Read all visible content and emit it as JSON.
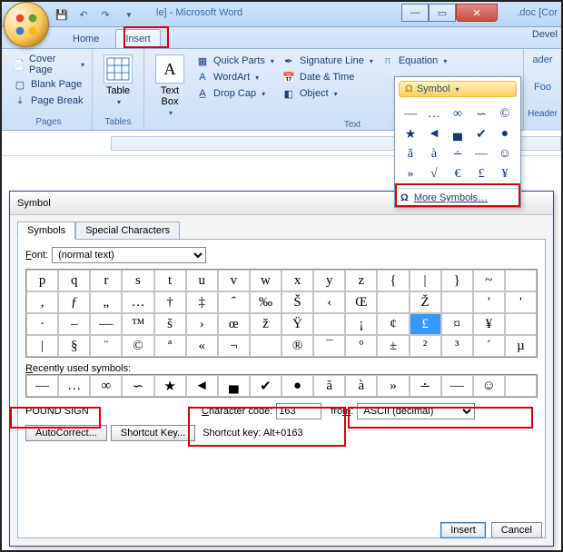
{
  "window": {
    "title": "le] - Microsoft Word",
    "doc_frag": ".doc [Cor",
    "min": "—",
    "max": "▭",
    "close": "✕"
  },
  "qat": {
    "save": "💾",
    "undo": "↶",
    "redo": "↷"
  },
  "tabs": {
    "home": "Home",
    "insert": "Insert",
    "right": "Devel"
  },
  "ribbon": {
    "pages": {
      "cover": "Cover Page",
      "blank": "Blank Page",
      "pbreak": "Page Break",
      "label": "Pages"
    },
    "tables": {
      "btn": "Table",
      "label": "Tables"
    },
    "text": {
      "box": "Text\nBox",
      "quick": "Quick Parts",
      "wordart": "WordArt",
      "drop": "Drop Cap",
      "sig": "Signature Line",
      "date": "Date & Time",
      "obj": "Object",
      "label": "Text"
    },
    "symbols": {
      "eq": "Equation",
      "sym": "Symbol",
      "more": "More Symbols…"
    },
    "right": {
      "ader": "ader",
      "foo": "Foo",
      "header": "Header"
    }
  },
  "gallery": [
    "—",
    "…",
    "∞",
    "∽",
    "©",
    "★",
    "◄",
    "▄",
    "✔",
    "●",
    "ă",
    "à",
    "∸",
    "—",
    "☺",
    "»",
    "√",
    "€",
    "£",
    "¥"
  ],
  "dialog": {
    "title": "Symbol",
    "tab_symbols": "Symbols",
    "tab_special": "Special Characters",
    "font_label": "Font:",
    "font_value": "(normal text)",
    "grid": [
      "p",
      "q",
      "r",
      "s",
      "t",
      "u",
      "v",
      "w",
      "x",
      "y",
      "z",
      "{",
      "|",
      "}",
      "~",
      "",
      ",",
      "ƒ",
      "„",
      "…",
      "†",
      "‡",
      "ˆ",
      "‰",
      "Š",
      "‹",
      "Œ",
      "",
      "Ž",
      "",
      "'",
      "'",
      "·",
      "–",
      "—",
      "™",
      "š",
      "›",
      "œ",
      "ž",
      "Ÿ",
      "",
      "¡",
      "¢",
      "£",
      "¤",
      "¥",
      "",
      "|",
      "§",
      "¨",
      "©",
      "ª",
      "«",
      "¬",
      "­",
      "®",
      "¯",
      "°",
      "±",
      "²",
      "³",
      "´",
      "µ"
    ],
    "selected_index": 44,
    "recent_label": "Recently used symbols:",
    "recent": [
      "—",
      "…",
      "∞",
      "∽",
      "★",
      "◄",
      "▄",
      "✔",
      "●",
      "ă",
      "à",
      "»",
      "∸",
      "—",
      "☺",
      ""
    ],
    "name": "POUND SIGN",
    "code_label": "Character code:",
    "code_value": "163",
    "from_label": "from:",
    "from_value": "ASCII (decimal)",
    "auto": "AutoCorrect...",
    "shortcut_btn": "Shortcut Key...",
    "shortcut": "Shortcut key: Alt+0163",
    "insert": "Insert",
    "cancel": "Cancel"
  }
}
